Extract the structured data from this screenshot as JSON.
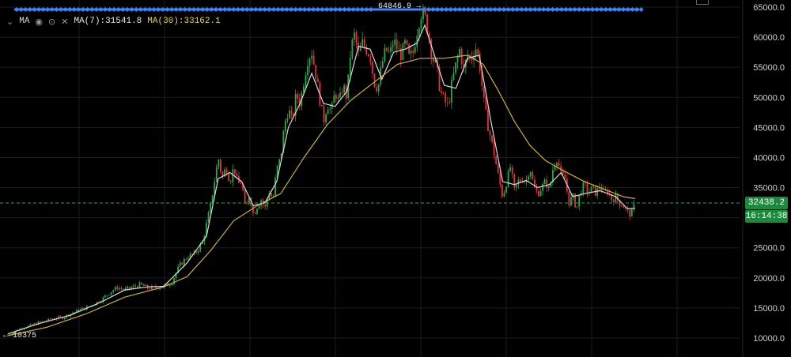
{
  "legend": {
    "indicator": "MA",
    "ma7_label": "MA(7):31541.8",
    "ma30_label": "MA(30):33162.1"
  },
  "annotations": {
    "high_label": "64846.9 →",
    "low_label": "← 10375",
    "current_price": "32438.2",
    "countdown": "16:14:38"
  },
  "icons": [
    "chevron-down-icon",
    "eye-icon",
    "settings-icon",
    "close-icon"
  ],
  "colors": {
    "background": "#000000",
    "bull": "#2aa84a",
    "bear": "#e0353b",
    "ma7": "#d9d9d9",
    "ma30": "#c9b23a",
    "grid": "#1c1c1c",
    "price_line": "#2aa84a",
    "top_marks": "#3a86ff"
  },
  "chart_data": {
    "type": "candlestick",
    "title": "",
    "xlabel": "",
    "ylabel": "",
    "ylim": [
      9000,
      65800
    ],
    "yticks": [
      10000,
      15000,
      20000,
      25000,
      30000,
      35000,
      40000,
      45000,
      50000,
      55000,
      60000,
      65000
    ],
    "ytick_labels": [
      "10000.0",
      "15000.0",
      "20000.0",
      "25000.0",
      "30000.0",
      "35000.0",
      "40000.0",
      "45000.0",
      "50000.0",
      "55000.0",
      "60000.0",
      "65000.0"
    ],
    "grid": true,
    "current_price": 32438.2,
    "high": 64846.9,
    "low": 10375,
    "close_points": [
      [
        0,
        10600
      ],
      [
        10,
        11200
      ],
      [
        20,
        11800
      ],
      [
        30,
        12100
      ],
      [
        40,
        12600
      ],
      [
        50,
        12900
      ],
      [
        60,
        13300
      ],
      [
        70,
        13400
      ],
      [
        80,
        14000
      ],
      [
        90,
        14600
      ],
      [
        100,
        15000
      ],
      [
        110,
        15600
      ],
      [
        120,
        16400
      ],
      [
        130,
        17500
      ],
      [
        140,
        18400
      ],
      [
        150,
        18000
      ],
      [
        160,
        18500
      ],
      [
        170,
        18900
      ],
      [
        180,
        18300
      ],
      [
        190,
        18400
      ],
      [
        200,
        18600
      ],
      [
        210,
        19200
      ],
      [
        220,
        22000
      ],
      [
        230,
        23500
      ],
      [
        240,
        24000
      ],
      [
        250,
        26000
      ],
      [
        260,
        32000
      ],
      [
        265,
        36000
      ],
      [
        270,
        40000
      ],
      [
        275,
        36500
      ],
      [
        280,
        38500
      ],
      [
        285,
        36000
      ],
      [
        290,
        38500
      ],
      [
        295,
        35500
      ],
      [
        300,
        36000
      ],
      [
        305,
        31000
      ],
      [
        310,
        34000
      ],
      [
        315,
        30500
      ],
      [
        320,
        32000
      ],
      [
        325,
        33000
      ],
      [
        330,
        31500
      ],
      [
        335,
        34500
      ],
      [
        340,
        33000
      ],
      [
        345,
        38000
      ],
      [
        350,
        40000
      ],
      [
        355,
        45500
      ],
      [
        360,
        48000
      ],
      [
        365,
        46000
      ],
      [
        370,
        50500
      ],
      [
        375,
        49000
      ],
      [
        380,
        53000
      ],
      [
        385,
        56500
      ],
      [
        390,
        57500
      ],
      [
        395,
        54000
      ],
      [
        400,
        50000
      ],
      [
        405,
        46000
      ],
      [
        410,
        49000
      ],
      [
        415,
        47500
      ],
      [
        420,
        51000
      ],
      [
        425,
        49000
      ],
      [
        430,
        52000
      ],
      [
        435,
        50000
      ],
      [
        440,
        58000
      ],
      [
        445,
        60500
      ],
      [
        450,
        57000
      ],
      [
        455,
        59000
      ],
      [
        460,
        58000
      ],
      [
        465,
        57000
      ],
      [
        470,
        52500
      ],
      [
        475,
        51500
      ],
      [
        480,
        55500
      ],
      [
        485,
        58000
      ],
      [
        490,
        57000
      ],
      [
        495,
        59500
      ],
      [
        500,
        58000
      ],
      [
        505,
        57000
      ],
      [
        510,
        59000
      ],
      [
        515,
        56500
      ],
      [
        520,
        57500
      ],
      [
        525,
        61000
      ],
      [
        530,
        64000
      ],
      [
        535,
        63500
      ],
      [
        540,
        60500
      ],
      [
        545,
        56500
      ],
      [
        550,
        55000
      ],
      [
        555,
        51000
      ],
      [
        560,
        49500
      ],
      [
        565,
        48500
      ],
      [
        570,
        52500
      ],
      [
        575,
        55500
      ],
      [
        580,
        58000
      ],
      [
        585,
        54500
      ],
      [
        590,
        57000
      ],
      [
        595,
        56500
      ],
      [
        600,
        58500
      ],
      [
        605,
        56000
      ],
      [
        610,
        50000
      ],
      [
        615,
        46000
      ],
      [
        620,
        43000
      ],
      [
        625,
        40000
      ],
      [
        630,
        36500
      ],
      [
        635,
        33500
      ],
      [
        640,
        36000
      ],
      [
        645,
        38500
      ],
      [
        650,
        34500
      ],
      [
        655,
        36000
      ],
      [
        660,
        36500
      ],
      [
        665,
        36000
      ],
      [
        670,
        38500
      ],
      [
        675,
        35000
      ],
      [
        680,
        34000
      ],
      [
        685,
        35000
      ],
      [
        690,
        36000
      ],
      [
        695,
        34500
      ],
      [
        700,
        38500
      ],
      [
        705,
        40000
      ],
      [
        710,
        37000
      ],
      [
        715,
        36500
      ],
      [
        720,
        32500
      ],
      [
        725,
        33500
      ],
      [
        730,
        31500
      ],
      [
        735,
        34500
      ],
      [
        740,
        35500
      ],
      [
        745,
        34000
      ],
      [
        750,
        35000
      ],
      [
        755,
        34000
      ],
      [
        760,
        35500
      ],
      [
        765,
        34000
      ],
      [
        770,
        34500
      ],
      [
        775,
        33000
      ],
      [
        780,
        33500
      ],
      [
        785,
        32500
      ],
      [
        790,
        32000
      ],
      [
        795,
        31000
      ],
      [
        800,
        30500
      ],
      [
        805,
        32438
      ]
    ],
    "ma7_points": [
      [
        0,
        10700
      ],
      [
        40,
        12400
      ],
      [
        80,
        13800
      ],
      [
        120,
        16000
      ],
      [
        150,
        18000
      ],
      [
        180,
        18500
      ],
      [
        200,
        18600
      ],
      [
        230,
        22500
      ],
      [
        255,
        27000
      ],
      [
        270,
        36500
      ],
      [
        285,
        37500
      ],
      [
        300,
        36000
      ],
      [
        315,
        32000
      ],
      [
        330,
        32500
      ],
      [
        345,
        36000
      ],
      [
        360,
        45000
      ],
      [
        375,
        49000
      ],
      [
        390,
        54000
      ],
      [
        405,
        49000
      ],
      [
        420,
        48500
      ],
      [
        435,
        51000
      ],
      [
        450,
        58500
      ],
      [
        465,
        58000
      ],
      [
        480,
        53000
      ],
      [
        495,
        57500
      ],
      [
        510,
        58000
      ],
      [
        525,
        59000
      ],
      [
        535,
        62000
      ],
      [
        545,
        58000
      ],
      [
        560,
        52000
      ],
      [
        575,
        51500
      ],
      [
        590,
        56500
      ],
      [
        605,
        57000
      ],
      [
        620,
        46000
      ],
      [
        635,
        36000
      ],
      [
        650,
        35500
      ],
      [
        665,
        36200
      ],
      [
        680,
        35000
      ],
      [
        695,
        35500
      ],
      [
        710,
        37500
      ],
      [
        725,
        33500
      ],
      [
        740,
        34000
      ],
      [
        760,
        34500
      ],
      [
        780,
        33500
      ],
      [
        795,
        31500
      ],
      [
        805,
        31541.8
      ]
    ],
    "ma30_points": [
      [
        0,
        10400
      ],
      [
        50,
        11800
      ],
      [
        100,
        14000
      ],
      [
        150,
        16800
      ],
      [
        200,
        18500
      ],
      [
        230,
        20200
      ],
      [
        260,
        24500
      ],
      [
        290,
        29500
      ],
      [
        320,
        32000
      ],
      [
        350,
        34000
      ],
      [
        380,
        40000
      ],
      [
        410,
        45500
      ],
      [
        440,
        49500
      ],
      [
        470,
        52500
      ],
      [
        500,
        55500
      ],
      [
        530,
        56500
      ],
      [
        560,
        56500
      ],
      [
        590,
        57000
      ],
      [
        610,
        55500
      ],
      [
        630,
        51000
      ],
      [
        650,
        46000
      ],
      [
        670,
        42000
      ],
      [
        690,
        39500
      ],
      [
        710,
        38000
      ],
      [
        740,
        36000
      ],
      [
        770,
        34500
      ],
      [
        790,
        33500
      ],
      [
        805,
        33162.1
      ]
    ]
  }
}
